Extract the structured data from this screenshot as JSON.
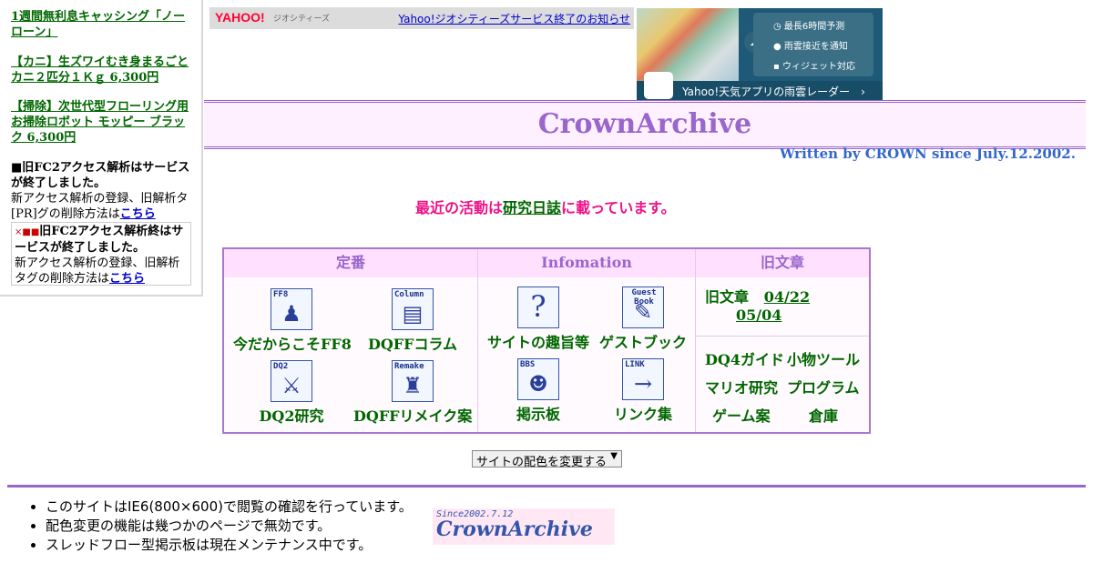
{
  "sidebar": {
    "ads": [
      "1週間無利息キャッシング「ノーローン」",
      "【カニ】生ズワイむき身まるごとカニ２匹分１Ｋｇ 6,300円",
      "【掃除】次世代型フローリング用お掃除ロボット モッピー ブラック 6,300円"
    ],
    "fc2_note_a": "■旧FC2アクセス解析はサービスが終了しました。",
    "fc2_note_b": "新アクセス解析の登録、旧解析タ",
    "fc2_pr": "[PR]",
    "fc2_note_c": "グの削除方法は",
    "fc2_link": "こちら",
    "box_prefix": "×■■",
    "box_text_a": "旧FC2アクセス解析終はサービスが終了しました。",
    "box_text_b": "新アクセス解析の登録、旧解析タグの削除方法は",
    "box_link": "こちら"
  },
  "banner": {
    "yahoo_logo": "YAHOO!",
    "yahoo_sub": "ジオシティーズ",
    "notice": "Yahoo!ジオシティーズサービス終了のお知らせ"
  },
  "weather_ad": {
    "rows": [
      "最長6時間予測",
      "雨雲接近を通知",
      "ウィジェット対応"
    ],
    "bottom": "Yahoo!天気アプリの雨雲レーダー　›"
  },
  "site": {
    "title": "CrownArchive",
    "byline": "Written by CROWN since July.12.2002."
  },
  "activity": {
    "prefix": "最近の活動は",
    "link": "研究日誌",
    "suffix": "に載っています。"
  },
  "menu": {
    "headers": [
      "定番",
      "Infomation",
      "旧文章"
    ],
    "standard": [
      {
        "label": "今だからこそFF8",
        "caption": "FF8"
      },
      {
        "label": "DQFFコラム",
        "caption": "Column"
      },
      {
        "label": "DQ2研究",
        "caption": "DQ2"
      },
      {
        "label": "DQFFリメイク案",
        "caption": "Remake"
      }
    ],
    "info": [
      {
        "label": "サイトの趣旨等",
        "caption": ""
      },
      {
        "label": "ゲストブック",
        "caption": "Guest Book"
      },
      {
        "label": "掲示板",
        "caption": "BBS"
      },
      {
        "label": "リンク集",
        "caption": "LINK"
      }
    ],
    "old": {
      "label": "旧文章",
      "link1": "04/22",
      "link2": "05/04"
    },
    "tools": [
      "DQ4ガイド",
      "小物ツール",
      "マリオ研究",
      "プログラム",
      "ゲーム案",
      "倉庫"
    ]
  },
  "color_select": {
    "value": "サイトの配色を変更する"
  },
  "footer": {
    "notes": [
      "このサイトはIE6(800×600)で閲覧の確認を行っています。",
      "配色変更の機能は幾つかのページで無効です。",
      "スレッドフロー型掲示板は現在メンテナンス中です。"
    ],
    "badge_since": "Since2002.7.12",
    "badge_name": "CrownArchive"
  }
}
